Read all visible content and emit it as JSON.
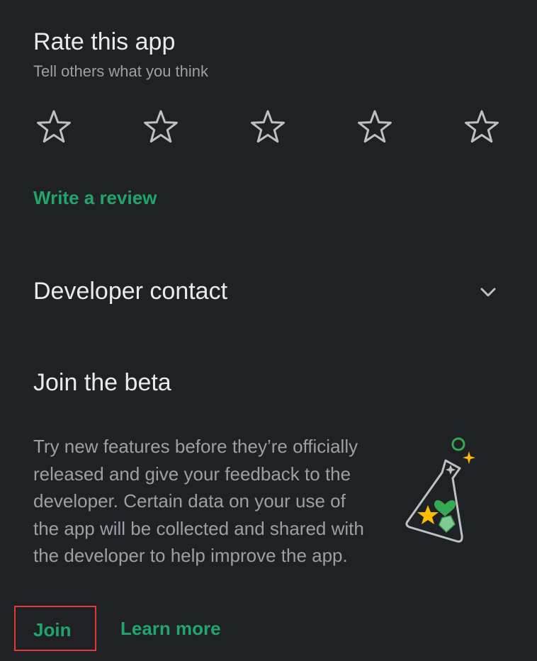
{
  "rate": {
    "title": "Rate this app",
    "subtitle": "Tell others what you think",
    "stars": [
      {
        "icon": "star-outline-icon"
      },
      {
        "icon": "star-outline-icon"
      },
      {
        "icon": "star-outline-icon"
      },
      {
        "icon": "star-outline-icon"
      },
      {
        "icon": "star-outline-icon"
      }
    ],
    "rating": 0,
    "write_review_label": "Write a review"
  },
  "developer_contact": {
    "title": "Developer contact",
    "icon": "chevron-down-icon"
  },
  "beta": {
    "title": "Join the beta",
    "description": "Try new features before they’re officially released and give your feedback to the developer. Certain data on your use of the app will be collected and shared with the developer to help improve the app.",
    "illustration_icon": "beta-flask-icon",
    "join_label": "Join",
    "learn_more_label": "Learn more"
  },
  "colors": {
    "background": "#202124",
    "primary_text": "#e8eaed",
    "secondary_text": "#9aa0a6",
    "accent_green": "#20a56b",
    "highlight_red": "#e53935"
  }
}
